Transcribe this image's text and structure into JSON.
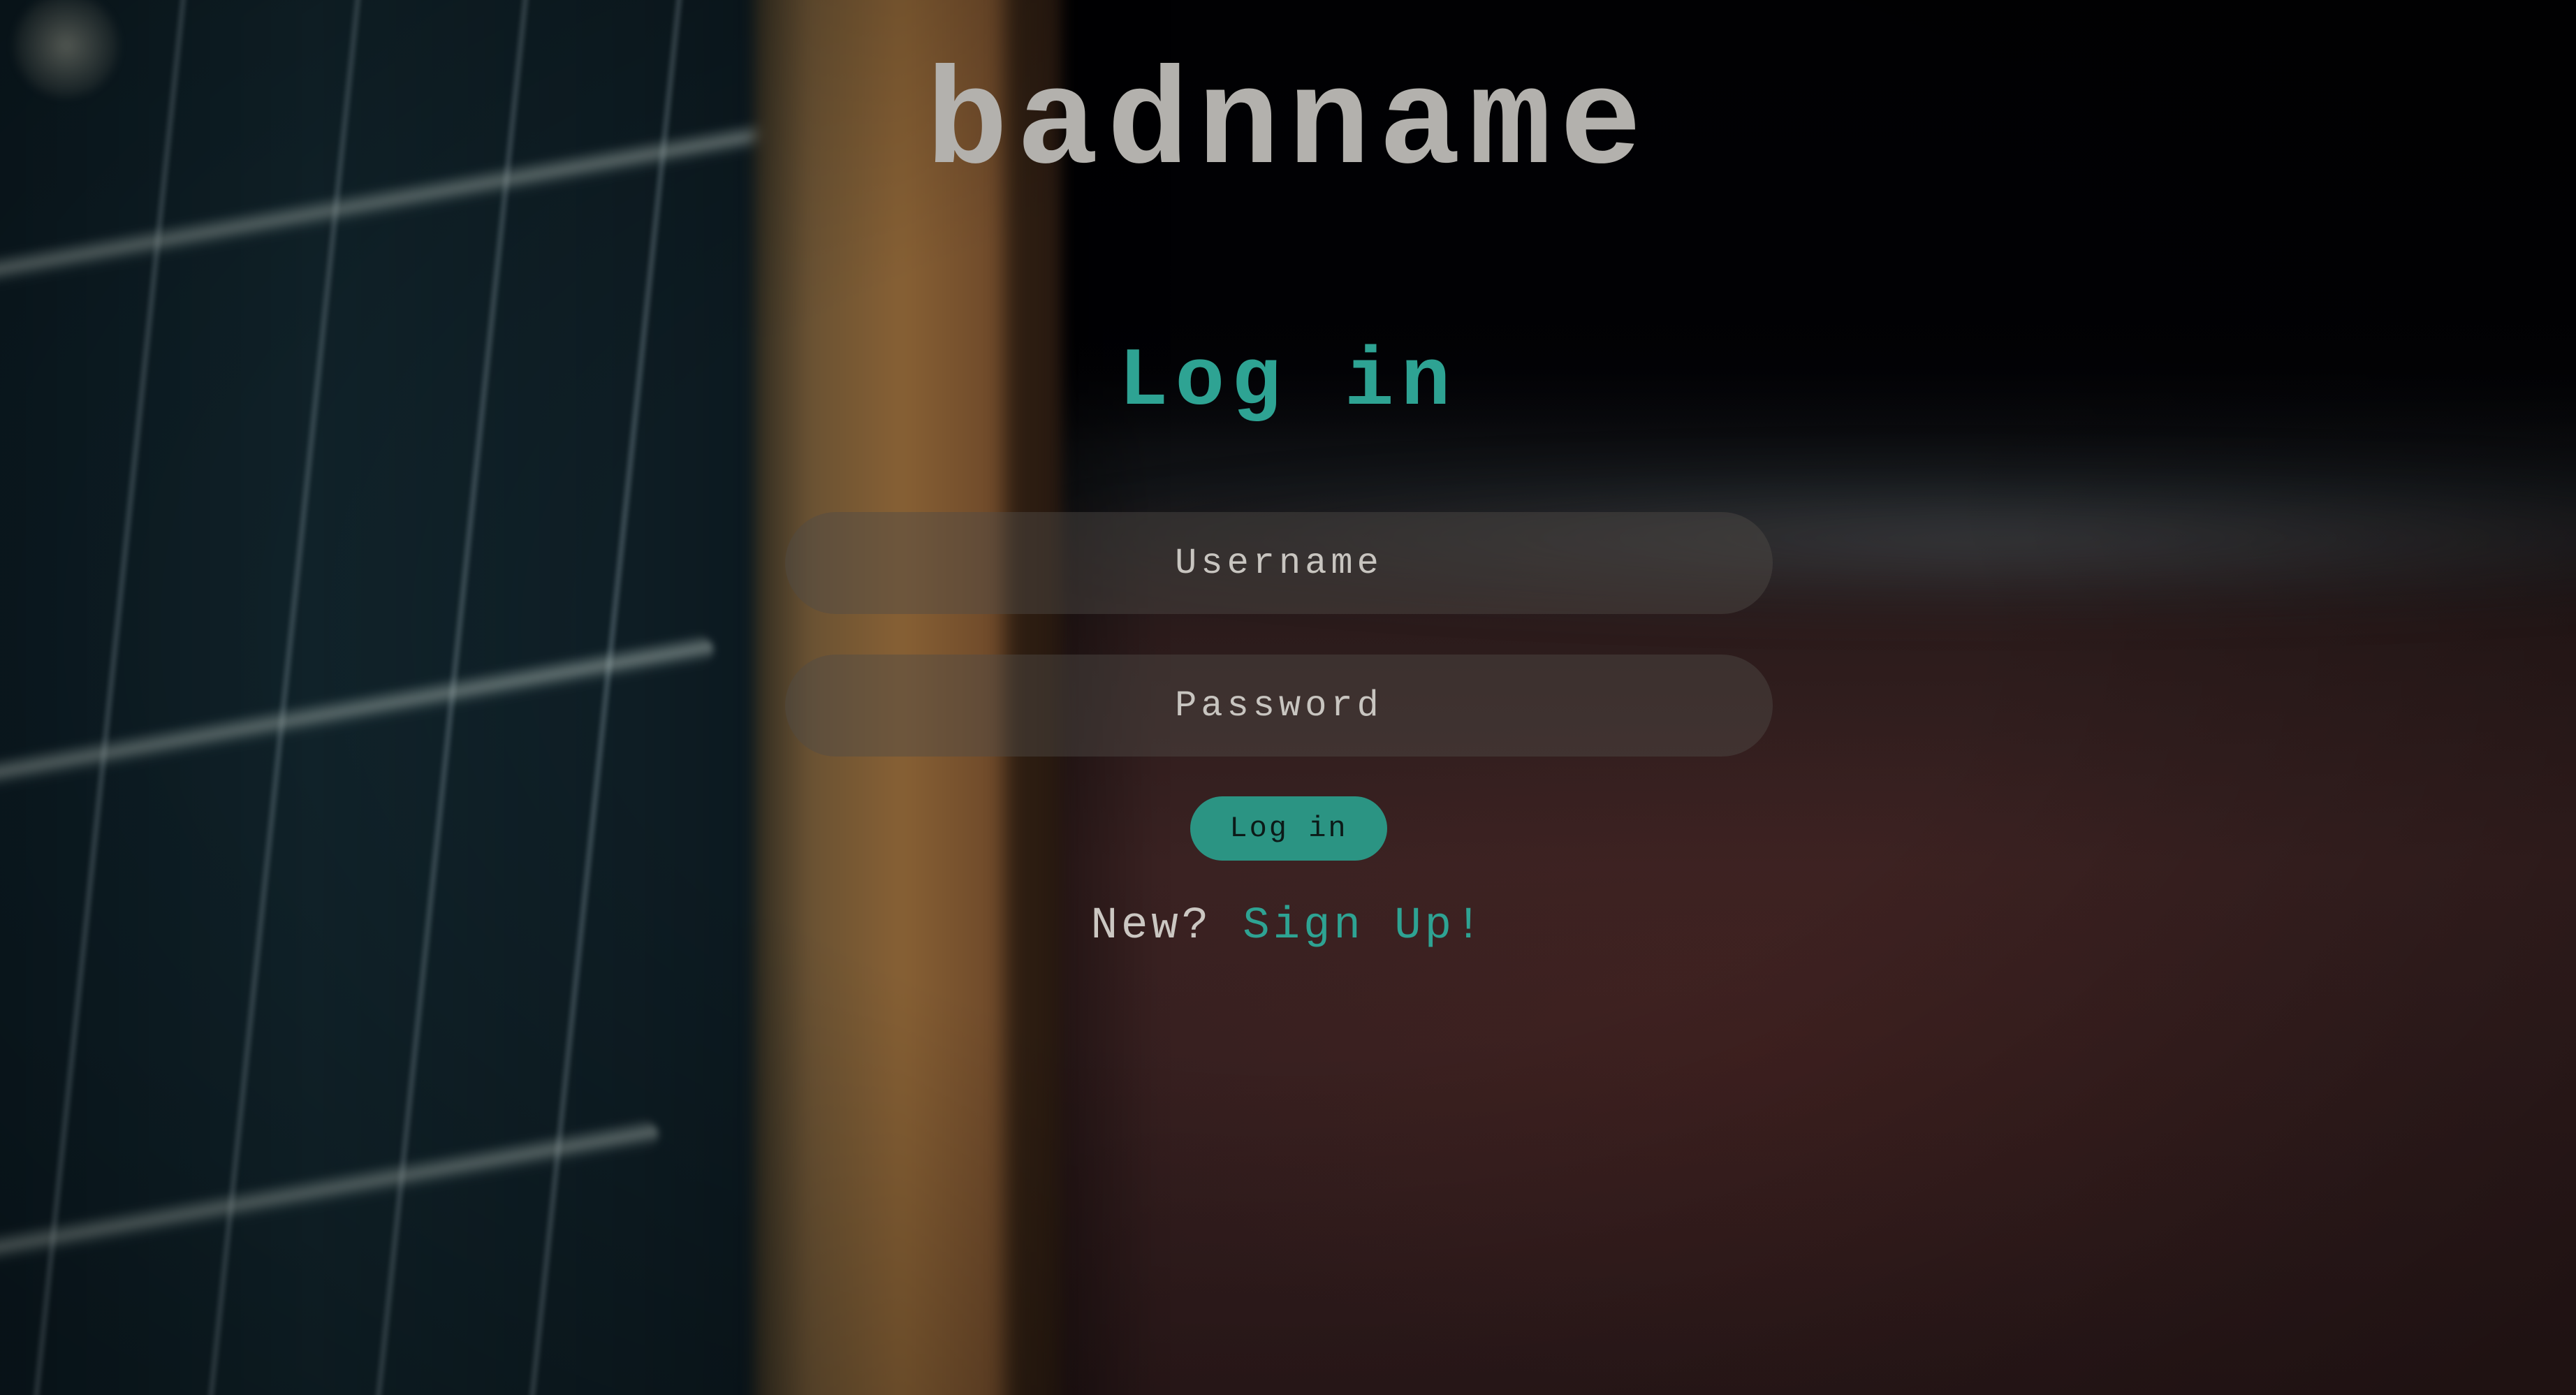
{
  "brand": {
    "name": "badnname"
  },
  "form": {
    "heading": "Log in",
    "username_placeholder": "Username",
    "password_placeholder": "Password",
    "submit_label": "Log in"
  },
  "signup": {
    "prompt": "New?",
    "link_label": "Sign Up!"
  },
  "colors": {
    "accent": "#2ea393",
    "button": "#2b9483",
    "brand_text": "#b3b1ad",
    "field_bg": "rgba(80,76,72,0.45)"
  }
}
